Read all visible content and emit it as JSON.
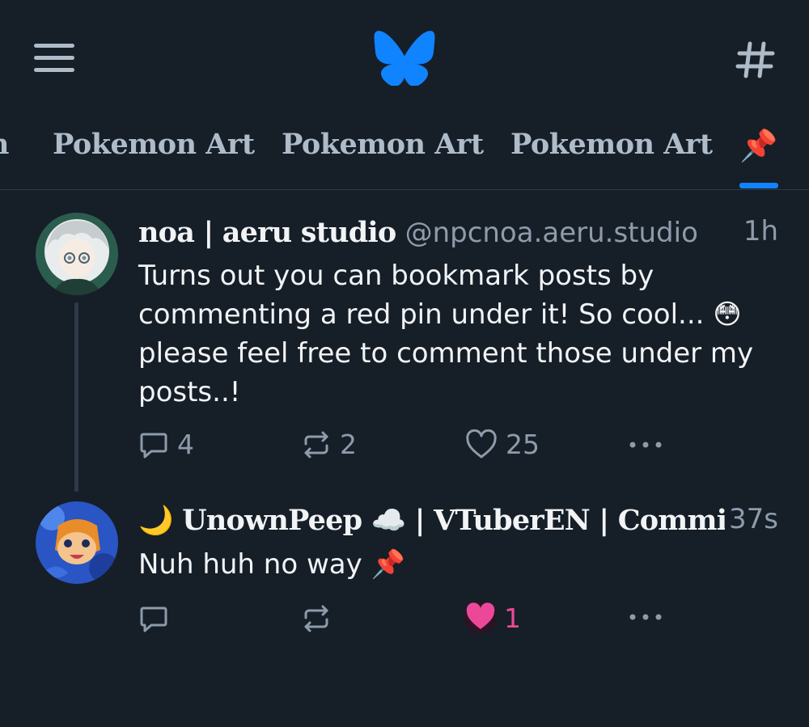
{
  "header": {
    "menu_icon": "hamburger-menu-icon",
    "logo_icon": "bluesky-butterfly-icon",
    "feeds_icon": "hashtag-icon",
    "brand_color": "#1083fe"
  },
  "tabs": {
    "partial_label": "n",
    "items": [
      {
        "label": "Pokemon Art"
      },
      {
        "label": "Pokemon Art"
      },
      {
        "label": "Pokemon Art"
      }
    ],
    "active_label": "📌"
  },
  "posts": [
    {
      "display_name": "noa | aeru studio",
      "handle": "@npcnoa.aeru.studio",
      "time": "1h",
      "text_lines": [
        "Turns out you can bookmark posts by",
        "commenting a red pin under it! So cool... 😳",
        "please feel free to comment those under my",
        "posts..!"
      ],
      "replies": "4",
      "reposts": "2",
      "likes": "25"
    },
    {
      "display_name": "🌙 UnownPeep ☁️ | VTuberEN | Commi...",
      "handle": "",
      "time": "37s",
      "text_lines": [
        "Nuh huh no way 📌"
      ],
      "likes": "1",
      "liked": true,
      "like_color": "#ec4899"
    }
  ]
}
